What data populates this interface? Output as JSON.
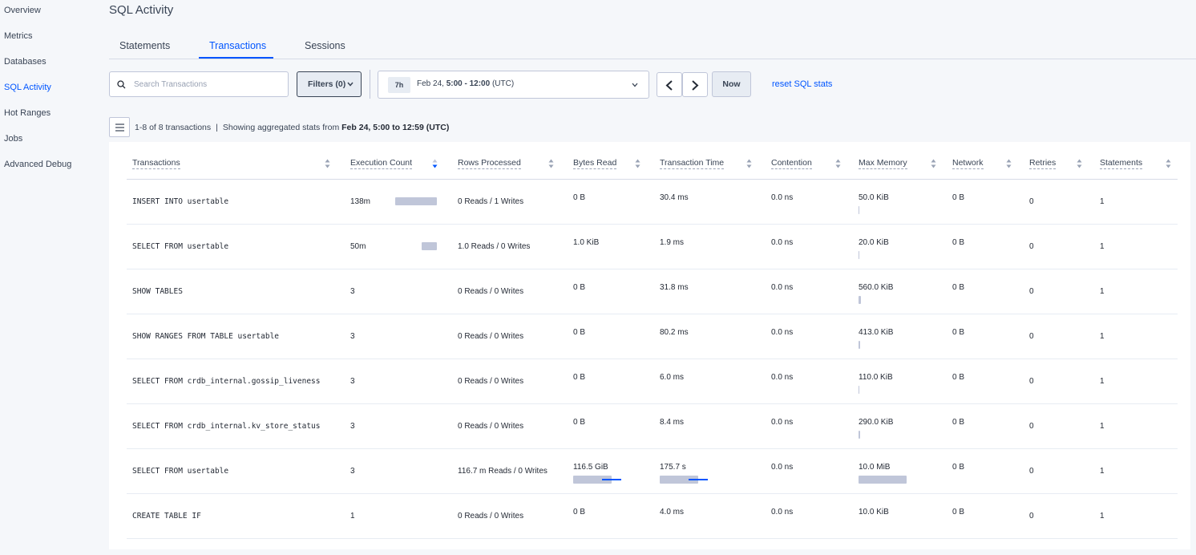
{
  "sidebar": {
    "items": [
      {
        "label": "Overview",
        "active": false
      },
      {
        "label": "Metrics",
        "active": false
      },
      {
        "label": "Databases",
        "active": false
      },
      {
        "label": "SQL Activity",
        "active": true
      },
      {
        "label": "Hot Ranges",
        "active": false
      },
      {
        "label": "Jobs",
        "active": false
      },
      {
        "label": "Advanced Debug",
        "active": false
      }
    ]
  },
  "page": {
    "title": "SQL Activity"
  },
  "tabs": [
    {
      "label": "Statements",
      "active": false
    },
    {
      "label": "Transactions",
      "active": true
    },
    {
      "label": "Sessions",
      "active": false
    }
  ],
  "toolbar": {
    "search_placeholder": "Search Transactions",
    "filters_label": "Filters (0)",
    "time_badge": "7h",
    "time_date": "Feb 24,",
    "time_range": "5:00 - 12:00",
    "time_zone": "(UTC)",
    "now_label": "Now",
    "reset_label": "reset SQL stats"
  },
  "summary": {
    "count": "1-8 of 8 transactions",
    "separator": "|",
    "prefix": "Showing aggregated stats from",
    "range": "Feb 24, 5:00 to 12:59 (UTC)"
  },
  "colors": {
    "accent": "#0055ff",
    "bar": "#c0c6d9",
    "text": "#242a35"
  },
  "table": {
    "sorted_column": "Execution Count",
    "columns": [
      "Transactions",
      "Execution Count",
      "Rows Processed",
      "Bytes Read",
      "Transaction Time",
      "Contention",
      "Max Memory",
      "Network",
      "Retries",
      "Statements"
    ],
    "rows": [
      {
        "transaction": "INSERT INTO usertable",
        "exec_count": "138m",
        "exec_frac": 1.0,
        "rows_processed": "0 Reads / 1 Writes",
        "bytes_read": "0 B",
        "bytes_frac": 0,
        "bytes_sd_frac": 0,
        "txn_time": "30.4 ms",
        "time_frac": 0,
        "time_sd_frac": 0,
        "contention": "0.0 ns",
        "max_memory": "50.0 KiB",
        "mem_frac": 0.005,
        "network": "0 B",
        "retries": "0",
        "statements": "1"
      },
      {
        "transaction": "SELECT FROM usertable",
        "exec_count": "50m",
        "exec_frac": 0.36,
        "rows_processed": "1.0 Reads / 0 Writes",
        "bytes_read": "1.0 KiB",
        "bytes_frac": 0,
        "bytes_sd_frac": 0,
        "txn_time": "1.9 ms",
        "time_frac": 0,
        "time_sd_frac": 0,
        "contention": "0.0 ns",
        "max_memory": "20.0 KiB",
        "mem_frac": 0.002,
        "network": "0 B",
        "retries": "0",
        "statements": "1"
      },
      {
        "transaction": "SHOW TABLES",
        "exec_count": "3",
        "exec_frac": 0,
        "rows_processed": "0 Reads / 0 Writes",
        "bytes_read": "0 B",
        "bytes_frac": 0,
        "bytes_sd_frac": 0,
        "txn_time": "31.8 ms",
        "time_frac": 0,
        "time_sd_frac": 0,
        "contention": "0.0 ns",
        "max_memory": "560.0 KiB",
        "mem_frac": 0.055,
        "network": "0 B",
        "retries": "0",
        "statements": "1"
      },
      {
        "transaction": "SHOW RANGES FROM TABLE usertable",
        "exec_count": "3",
        "exec_frac": 0,
        "rows_processed": "0 Reads / 0 Writes",
        "bytes_read": "0 B",
        "bytes_frac": 0,
        "bytes_sd_frac": 0,
        "txn_time": "80.2 ms",
        "time_frac": 0,
        "time_sd_frac": 0,
        "contention": "0.0 ns",
        "max_memory": "413.0 KiB",
        "mem_frac": 0.04,
        "network": "0 B",
        "retries": "0",
        "statements": "1"
      },
      {
        "transaction": "SELECT FROM crdb_internal.gossip_liveness",
        "exec_count": "3",
        "exec_frac": 0,
        "rows_processed": "0 Reads / 0 Writes",
        "bytes_read": "0 B",
        "bytes_frac": 0,
        "bytes_sd_frac": 0,
        "txn_time": "6.0 ms",
        "time_frac": 0,
        "time_sd_frac": 0,
        "contention": "0.0 ns",
        "max_memory": "110.0 KiB",
        "mem_frac": 0.011,
        "network": "0 B",
        "retries": "0",
        "statements": "1"
      },
      {
        "transaction": "SELECT FROM crdb_internal.kv_store_status",
        "exec_count": "3",
        "exec_frac": 0,
        "rows_processed": "0 Reads / 0 Writes",
        "bytes_read": "0 B",
        "bytes_frac": 0,
        "bytes_sd_frac": 0,
        "txn_time": "8.4 ms",
        "time_frac": 0,
        "time_sd_frac": 0,
        "contention": "0.0 ns",
        "max_memory": "290.0 KiB",
        "mem_frac": 0.028,
        "network": "0 B",
        "retries": "0",
        "statements": "1"
      },
      {
        "transaction": "SELECT FROM usertable",
        "exec_count": "3",
        "exec_frac": 0,
        "rows_processed": "116.7 m Reads / 0 Writes",
        "bytes_read": "116.5 GiB",
        "bytes_frac": 0.8,
        "bytes_sd_frac": 0.4,
        "txn_time": "175.7 s",
        "time_frac": 0.8,
        "time_sd_frac": 0.4,
        "contention": "0.0 ns",
        "max_memory": "10.0 MiB",
        "mem_frac": 1.0,
        "network": "0 B",
        "retries": "0",
        "statements": "1"
      },
      {
        "transaction": "CREATE TABLE IF",
        "exec_count": "1",
        "exec_frac": 0,
        "rows_processed": "0 Reads / 0 Writes",
        "bytes_read": "0 B",
        "bytes_frac": 0,
        "bytes_sd_frac": 0,
        "txn_time": "4.0 ms",
        "time_frac": 0,
        "time_sd_frac": 0,
        "contention": "0.0 ns",
        "max_memory": "10.0 KiB",
        "mem_frac": 0,
        "network": "0 B",
        "retries": "0",
        "statements": "1"
      }
    ]
  }
}
